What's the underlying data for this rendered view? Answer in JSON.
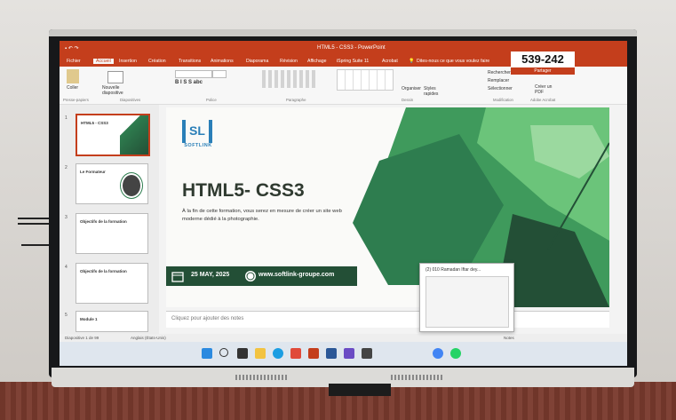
{
  "window": {
    "title": "HTML5 - CSS3 - PowerPoint"
  },
  "ribbon_tabs": [
    "Fichier",
    "Accueil",
    "Insertion",
    "Création",
    "Transitions",
    "Animations",
    "Diaporama",
    "Révision",
    "Affichage",
    "iSpring Suite 11",
    "Acrobat"
  ],
  "search": {
    "placeholder": "Dites-nous ce que vous voulez faire"
  },
  "ribbon": {
    "paste": "Coller",
    "new_slide": "Nouvelle diapositive",
    "groups": [
      "Presse-papiers",
      "Diapositives",
      "Police",
      "Paragraphe",
      "Dessin",
      "Modification",
      "Adobe Acrobat"
    ],
    "arrange": "Organiser",
    "quick_styles": "Styles rapides",
    "find": "Rechercher",
    "replace": "Remplacer",
    "select": "Sélectionner",
    "create_pdf": "Créer un PDF"
  },
  "counter": "539-242",
  "share": "Partager",
  "slides": [
    {
      "num": "1",
      "title": "HTML5 - CSS3"
    },
    {
      "num": "2",
      "title": "Le Formateur"
    },
    {
      "num": "3",
      "title": "Objectifs de la formation"
    },
    {
      "num": "4",
      "title": "Objectifs de la formation"
    },
    {
      "num": "5",
      "title": "Module 1"
    }
  ],
  "slide": {
    "logo": "SL",
    "logo_brand": "SOFTLINK",
    "title": "HTML5- CSS3",
    "subtitle": "À la fin de cette formation, vous serez en mesure de créer un site web moderne dédié à la photographie.",
    "date": "25 MAY, 2025",
    "website": "www.softlink-groupe.com"
  },
  "notes_placeholder": "Cliquez pour ajouter des notes",
  "status": {
    "slide_info": "Diapositive 1 de 99",
    "language": "Anglais (États-Unis)",
    "notes": "Notes"
  },
  "popup": {
    "title": "(2) 010 Ramadan Iftar dey..."
  },
  "colors": {
    "ppt_red": "#c43e1c",
    "green_dark": "#234f36",
    "green_mid": "#2e7d4f",
    "green_light": "#6bc47a"
  }
}
